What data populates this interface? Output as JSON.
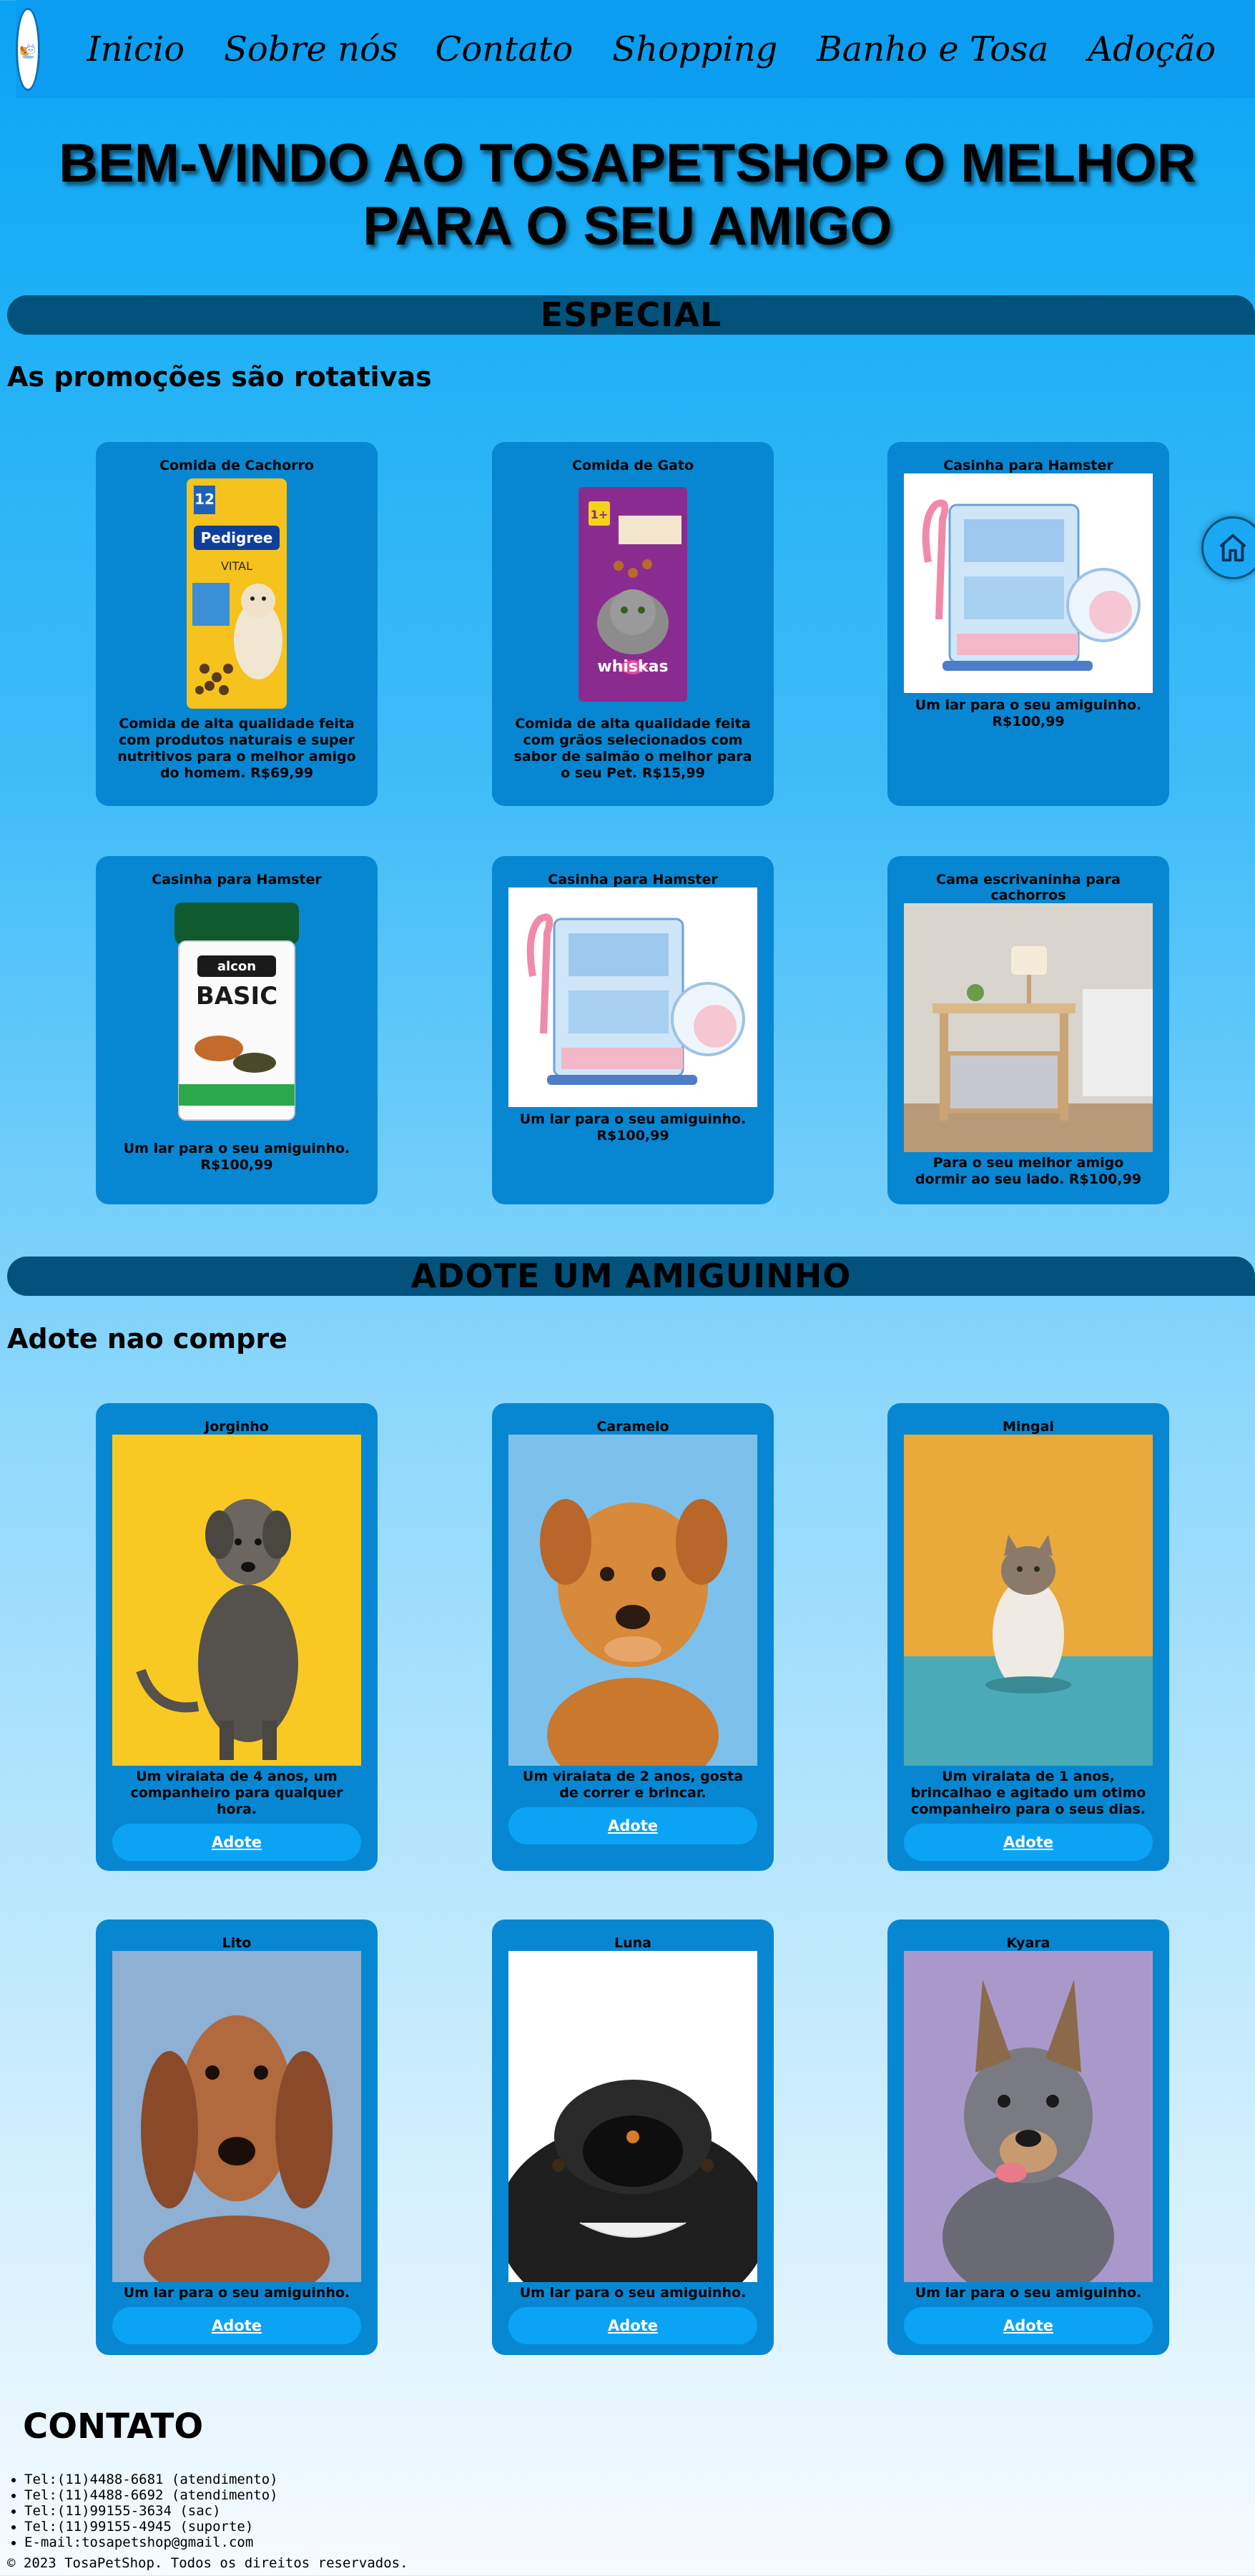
{
  "nav": {
    "items": [
      "Inicio",
      "Sobre nós",
      "Contato",
      "Shopping",
      "Banho e Tosa",
      "Adoção"
    ]
  },
  "hero": {
    "line1": "BEM-VINDO AO TOSAPETSHOP O MELHOR",
    "line2": "PARA O SEU AMIGO"
  },
  "special": {
    "heading": "ESPECIAL",
    "subtitle": "As promoções são rotativas",
    "products": [
      {
        "title": "Comida de Cachorro",
        "desc": "Comida de alta qualidade feita com produtos naturais e super nutritivos para o melhor amigo do homem. R$69,99",
        "image": "pedigree-bag"
      },
      {
        "title": "Comida de Gato",
        "desc": "Comida de alta qualidade feita com grãos selecionados com sabor de salmão o melhor para o seu Pet. R$15,99",
        "image": "whiskas-bag"
      },
      {
        "title": "Casinha para Hamster",
        "desc": "Um lar para o seu amiguinho. R$100,99",
        "image": "hamster-cage"
      },
      {
        "title": "Casinha para Hamster",
        "desc": "Um lar para o seu amiguinho. R$100,99",
        "image": "fish-food-jar"
      },
      {
        "title": "Casinha para Hamster",
        "desc": "Um lar para o seu amiguinho. R$100,99",
        "image": "hamster-cage"
      },
      {
        "title": "Cama escrivaninha para cachorros",
        "desc": "Para o seu melhor amigo dormir ao seu lado. R$100,99",
        "image": "dog-bed-desk"
      }
    ]
  },
  "adopt": {
    "heading": "ADOTE UM AMIGUINHO",
    "subtitle": "Adote nao compre",
    "button_label": "Adote",
    "pets": [
      {
        "name": "Jorginho",
        "desc": "Um viralata de 4 anos, um companheiro para qualquer hora.",
        "bg": "#f9c923"
      },
      {
        "name": "Caramelo",
        "desc": "Um viralata de 2 anos, gosta de correr e brincar.",
        "bg": "#7cc1ec"
      },
      {
        "name": "Mingal",
        "desc": "Um viralata de 1 anos, brincalhao e agitado um otimo companheiro para o seus dias.",
        "bg": "#e9a93b"
      },
      {
        "name": "Lito",
        "desc": "Um lar para o seu amiguinho.",
        "bg": "#8db0d3"
      },
      {
        "name": "Luna",
        "desc": "Um lar para o seu amiguinho.",
        "bg": "#ffffff"
      },
      {
        "name": "Kyara",
        "desc": "Um lar para o seu amiguinho.",
        "bg": "#a999cb"
      }
    ]
  },
  "contact": {
    "heading": "CONTATO",
    "items": [
      "Tel:(11)4488-6681 (atendimento)",
      "Tel:(11)4488-6692 (atendimento)",
      "Tel:(11)99155-3634 (sac)",
      "Tel:(11)99155-4945 (suporte)",
      "E-mail:tosapetshop@gmail.com"
    ]
  },
  "footer": {
    "copyright": "© 2023 TosaPetShop. Todos os direitos reservados."
  },
  "colors": {
    "nav": "#0b9ef0",
    "bar": "#02527c",
    "card": "#0787d2",
    "button": "#0ba4f5"
  }
}
